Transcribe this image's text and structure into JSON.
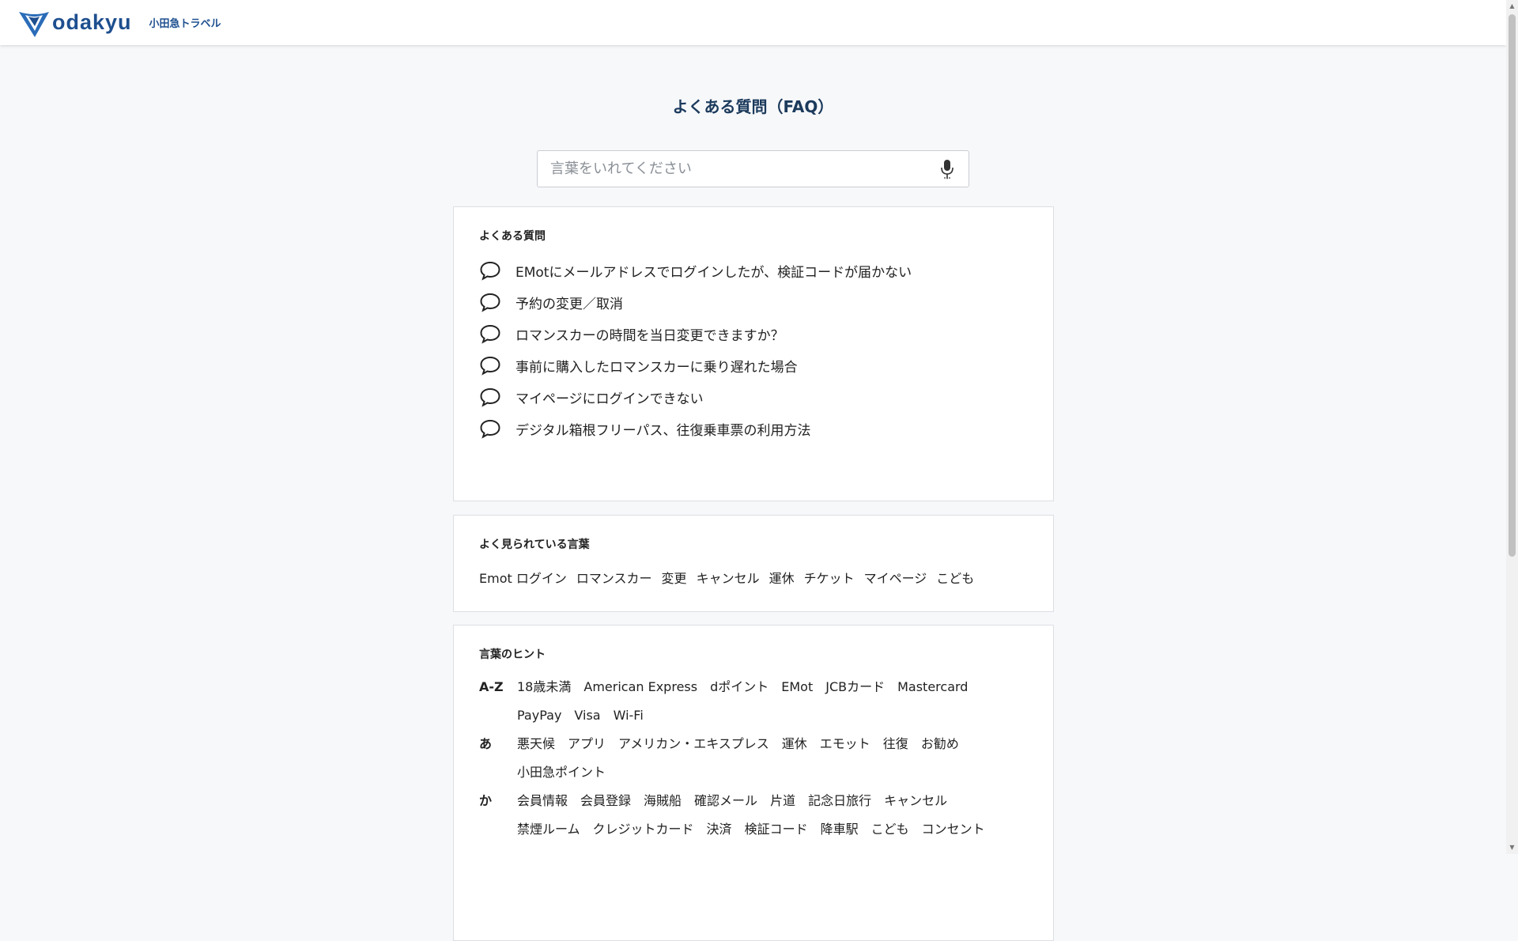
{
  "header": {
    "logo_word": "odakyu",
    "logo_sub": "小田急トラベル"
  },
  "page": {
    "title": "よくある質問（FAQ）"
  },
  "search": {
    "placeholder": "言葉をいれてください"
  },
  "faq": {
    "heading": "よくある質問",
    "items": [
      "EMotにメールアドレスでログインしたが、検証コードが届かない",
      "予約の変更／取消",
      "ロマンスカーの時間を当日変更できますか？",
      "事前に購入したロマンスカーに乗り遅れた場合",
      "マイページにログインできない",
      "デジタル箱根フリーパス、往復乗車票の利用方法"
    ]
  },
  "popular": {
    "heading": "よく見られている言葉",
    "items": [
      "Emot ログイン",
      "ロマンスカー",
      "変更",
      "キャンセル",
      "運休",
      "チケット",
      "マイページ",
      "こども"
    ]
  },
  "hints": {
    "heading": "言葉のヒント",
    "rows": [
      {
        "key": "A-Z",
        "words": [
          "18歳未満",
          "American Express",
          "dポイント",
          "EMot",
          "JCBカード",
          "Mastercard",
          "PayPay",
          "Visa",
          "Wi-Fi"
        ]
      },
      {
        "key": "あ",
        "words": [
          "悪天候",
          "アプリ",
          "アメリカン・エキスプレス",
          "運休",
          "エモット",
          "往復",
          "お勧め",
          "小田急ポイント"
        ]
      },
      {
        "key": "か",
        "words": [
          "会員情報",
          "会員登録",
          "海賊船",
          "確認メール",
          "片道",
          "記念日旅行",
          "キャンセル",
          "禁煙ルーム",
          "クレジットカード",
          "決済",
          "検証コード",
          "降車駅",
          "こども",
          "コンセント"
        ]
      }
    ]
  },
  "colors": {
    "brand": "#1e4f8f",
    "title": "#1b3a5c",
    "background": "#f7f8fa"
  }
}
